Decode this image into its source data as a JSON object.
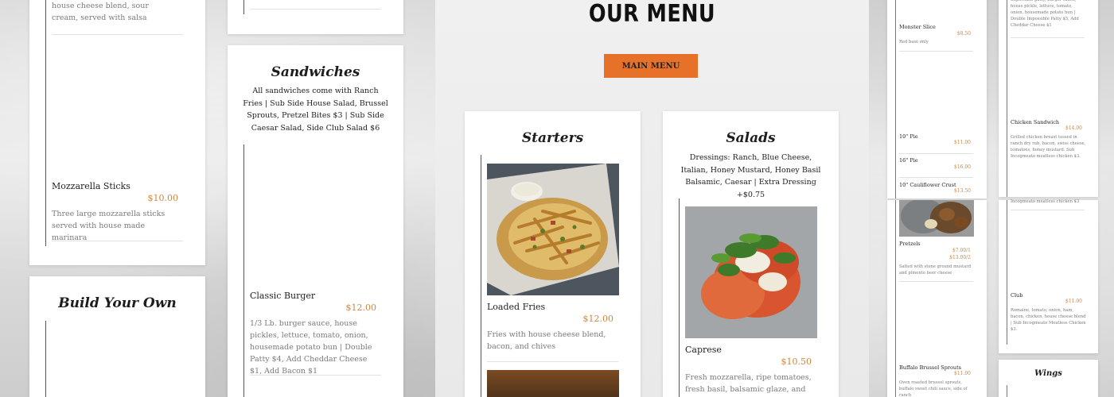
{
  "page": {
    "title": "OUR MENU",
    "main_menu_button": "MAIN MENU"
  },
  "left_column": {
    "top_card": {
      "desc_tail": "house cheese blend, sour cream, served with salsa",
      "item": {
        "name": "Mozzarella Sticks",
        "price": "$10.00",
        "desc": "Three large mozzarella sticks served with house made marinara"
      }
    },
    "build_your_own": {
      "title": "Build Your Own"
    }
  },
  "second_column": {
    "sandwiches": {
      "title": "Sandwiches",
      "note": "All sandwiches come with Ranch Fries | Sub Side House Salad, Brussel Sprouts, Pretzel Bites $3 | Sub Side Caesar Salad, Side Club Salad $6",
      "item": {
        "name": "Classic Burger",
        "price": "$12.00",
        "desc": "1/3 Lb. burger sauce, house pickles, lettuce, tomato, onion, housemade potato bun | Double Patty $4, Add Cheddar Cheese $1, Add Bacon $1"
      }
    }
  },
  "starters": {
    "title": "Starters",
    "item": {
      "name": "Loaded Fries",
      "price": "$12.00",
      "desc": "Fries with house cheese blend, bacon, and chives"
    }
  },
  "salads": {
    "title": "Salads",
    "note": "Dressings: Ranch, Blue Cheese, Italian, Honey Mustard, Honey Basil Balsamic, Caesar | Extra Dressing +$0.75",
    "item": {
      "name": "Caprese",
      "price": "$10.50",
      "desc": "Fresh mozzarella, ripe tomatoes, fresh basil, balsamic glaze, and olive"
    }
  },
  "mini_left": {
    "items": [
      {
        "name": "Monster Slice",
        "price": "$8.50",
        "desc": "Red base only"
      },
      {
        "name": "10\" Pie",
        "price": "$11.00"
      },
      {
        "name": "16\" Pie",
        "price": "$16.00"
      },
      {
        "name": "10\" Cauliflower Crust",
        "price": "$13.50"
      }
    ],
    "pretzels": {
      "name": "Pretzels",
      "price": "$7.00/1\n$13.00/2",
      "desc": "Salted with stone ground mustard and pimento beer cheese"
    },
    "sprouts": {
      "name": "Buffalo Brussel Sprouts",
      "price": "$11.00",
      "desc": "Oven roasted brussel sprouts, buffalo sweet chili sauce, side of ranch"
    }
  },
  "mini_right": {
    "top_desc": "Impossible patty, burger sauce, house pickle, lettuce, tomato, onion, housemade potato bun | Double Impossible Patty $5, Add Cheddar Cheese $1",
    "chicken": {
      "name": "Chicken Sandwich",
      "price": "$14.00",
      "desc": "Grilled chicken breast tossed in ranch dry rub, bacon, swiss cheese, tomatoes, honey mustard. Sub Incogmeato meatless chicken $3."
    },
    "partial": "Incogmeato meatless chicken $3",
    "club": {
      "name": "Club",
      "price": "$11.00",
      "desc": "Romaine, tomato, onion, ham, bacon, chicken, house cheese blend | Sub Incogmeato Meatless Chicken $3."
    },
    "wings_title": "Wings"
  },
  "colors": {
    "accent": "#e8712a",
    "price": "#d0863c"
  }
}
